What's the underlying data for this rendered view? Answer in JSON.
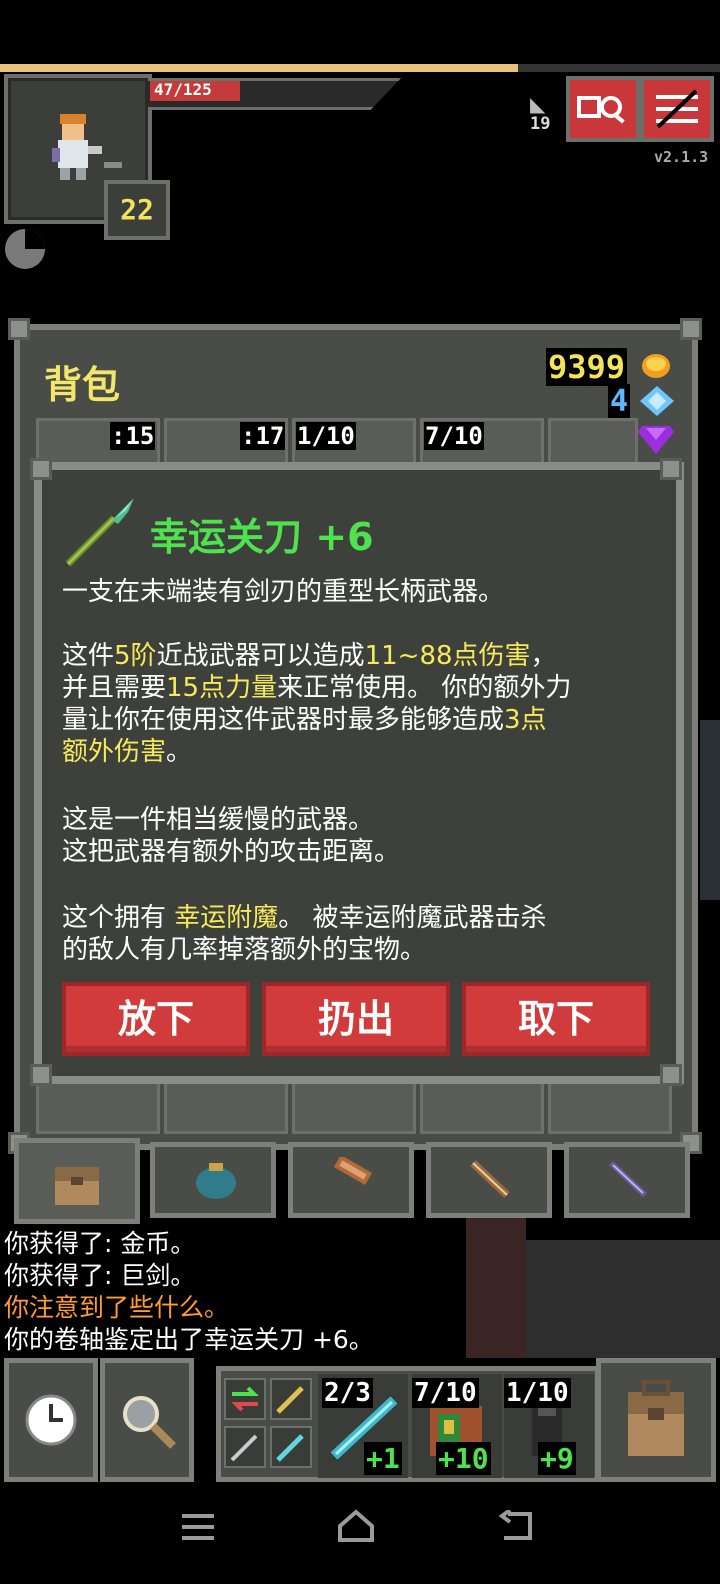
{
  "status": {
    "hp_text": "47/125",
    "hp_fraction": 0.376,
    "xp_fraction": 0.72,
    "level": "22",
    "depth": "19",
    "version": "v2.1.3"
  },
  "backpack": {
    "title": "背包",
    "gold": "9399",
    "energy": "4",
    "slot_quantities": [
      ":15",
      ":17",
      "1/10",
      "7/10"
    ]
  },
  "item": {
    "name": "幸运关刀 +6",
    "desc_line1": "一支在末端装有剑刃的重型长柄武器。",
    "p2": {
      "a": "这件",
      "tier": "5阶",
      "b": "近战武器可以造成",
      "damage": "11~88点伤害",
      "c": "，",
      "d": "并且需要",
      "strength": "15点力量",
      "e": "来正常使用。 你的额外力",
      "f": "量让你在使用这件武器时最多能够造成",
      "bonus": "3点",
      "g": "额外伤害",
      "h": "。"
    },
    "p3_line1": "这是一件相当缓慢的武器。",
    "p3_line2": "这把武器有额外的攻击距离。",
    "p4": {
      "a": "这个拥有 ",
      "enchant": "幸运附魔",
      "b": "。 被幸运附魔武器击杀",
      "c": "的敌人有几率掉落额外的宝物。"
    },
    "buttons": {
      "drop": "放下",
      "throw": "扔出",
      "unequip": "取下"
    }
  },
  "log": [
    {
      "text": "你获得了: 金币。",
      "color": "#ffffff"
    },
    {
      "text": "你获得了: 巨剑。",
      "color": "#ffffff"
    },
    {
      "text": "你注意到了些什么。",
      "color": "#ff9b2f"
    },
    {
      "text": "你的卷轴鉴定出了幸运关刀 +6。",
      "color": "#ffffff"
    }
  ],
  "quickslots": [
    {
      "count": "2/3",
      "plus": "+1"
    },
    {
      "count": "7/10",
      "plus": "+10"
    },
    {
      "count": "1/10",
      "plus": "+9"
    }
  ],
  "colors": {
    "accent_green": "#4ee24e",
    "highlight_yellow": "#f6ea5b",
    "button_red": "#d23b3b",
    "warning_orange": "#ff9b2f"
  }
}
